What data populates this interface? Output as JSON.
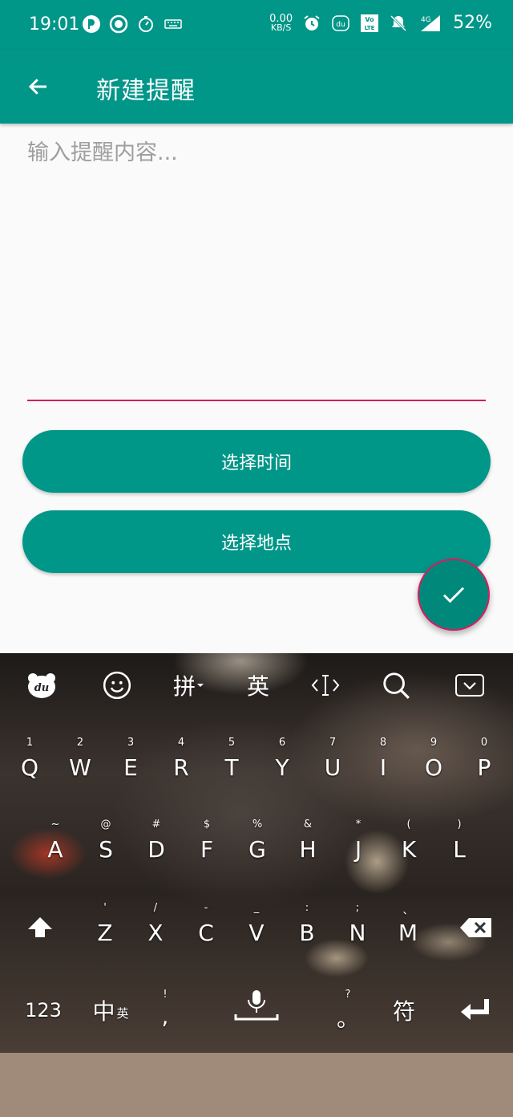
{
  "status_bar": {
    "time": "19:01",
    "net_speed_value": "0.00",
    "net_speed_unit": "KB/S",
    "network_type": "4G",
    "battery": "52%",
    "volte_top": "Vo",
    "volte_bottom": "LTE",
    "du_badge": "du"
  },
  "app_bar": {
    "title": "新建提醒",
    "back_icon": "arrow-left-icon"
  },
  "form": {
    "content_placeholder": "输入提醒内容...",
    "content_value": "",
    "select_time_label": "选择时间",
    "select_place_label": "选择地点",
    "confirm_icon": "check-icon"
  },
  "colors": {
    "primary": "#009688",
    "accent": "#d81b60",
    "background": "#fafafa"
  },
  "keyboard": {
    "toolbar": {
      "logo": "du",
      "emoji_icon": "smiley-icon",
      "pinyin": "拼",
      "english": "英",
      "cursor_icon": "cursor-icon",
      "search_icon": "search-icon",
      "hide_icon": "keyboard-hide-icon"
    },
    "row1": [
      {
        "hint": "1",
        "key": "Q"
      },
      {
        "hint": "2",
        "key": "W"
      },
      {
        "hint": "3",
        "key": "E"
      },
      {
        "hint": "4",
        "key": "R"
      },
      {
        "hint": "5",
        "key": "T"
      },
      {
        "hint": "6",
        "key": "Y"
      },
      {
        "hint": "7",
        "key": "U"
      },
      {
        "hint": "8",
        "key": "I"
      },
      {
        "hint": "9",
        "key": "O"
      },
      {
        "hint": "0",
        "key": "P"
      }
    ],
    "row2": [
      {
        "hint": "~",
        "key": "A"
      },
      {
        "hint": "@",
        "key": "S"
      },
      {
        "hint": "#",
        "key": "D"
      },
      {
        "hint": "$",
        "key": "F"
      },
      {
        "hint": "%",
        "key": "G"
      },
      {
        "hint": "&",
        "key": "H"
      },
      {
        "hint": "*",
        "key": "J"
      },
      {
        "hint": "(",
        "key": "K"
      },
      {
        "hint": ")",
        "key": "L"
      }
    ],
    "row3": [
      {
        "hint": "'",
        "key": "Z"
      },
      {
        "hint": "/",
        "key": "X"
      },
      {
        "hint": "-",
        "key": "C"
      },
      {
        "hint": "_",
        "key": "V"
      },
      {
        "hint": ":",
        "key": "B"
      },
      {
        "hint": ";",
        "key": "N"
      },
      {
        "hint": "、",
        "key": "M"
      }
    ],
    "row4": {
      "numbers": "123",
      "lang_main": "中",
      "lang_sub": "英",
      "comma_hint": "!",
      "comma": ",",
      "period_hint": "?",
      "period": "。",
      "symbols": "符"
    }
  }
}
